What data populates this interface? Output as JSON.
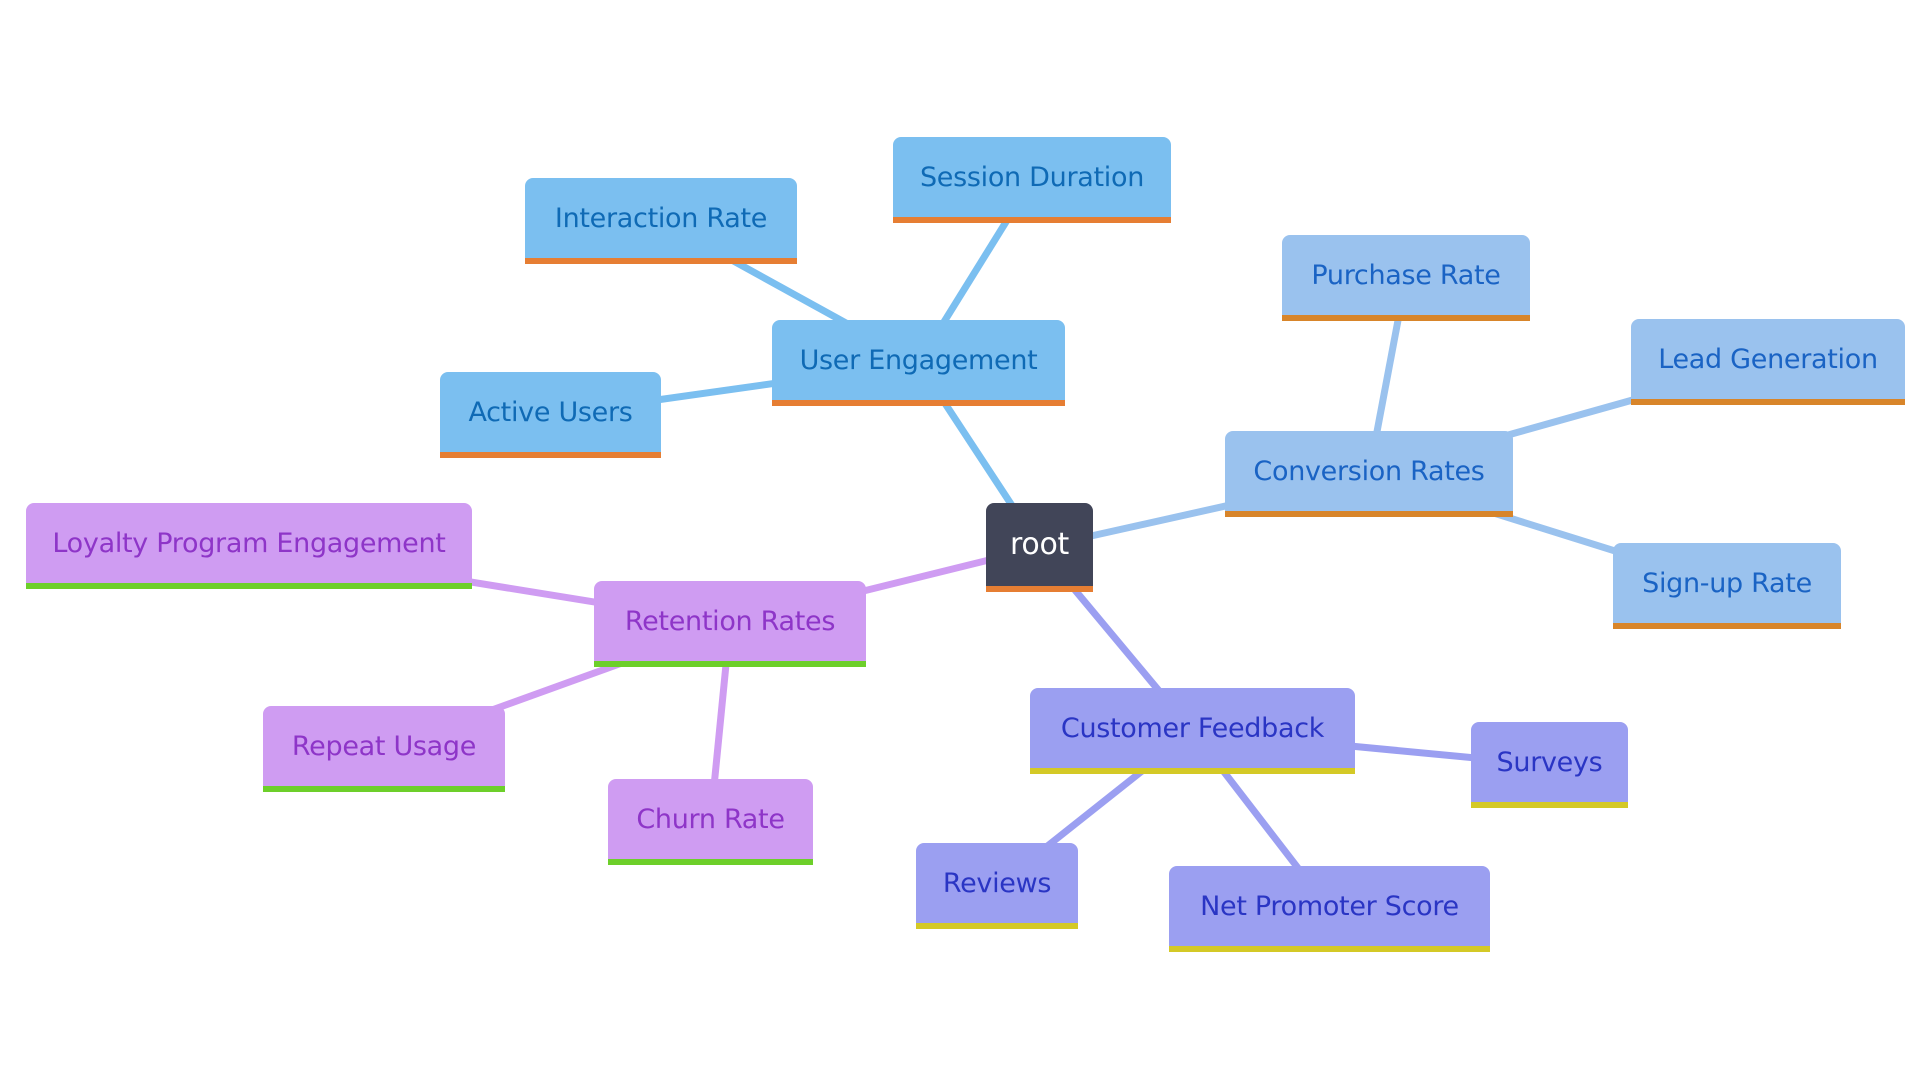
{
  "diagram": {
    "type": "mindmap",
    "root": {
      "id": "root",
      "label": "root",
      "fill": "#414558",
      "text_color": "#ffffff",
      "bar_color": "#E67E33"
    },
    "branches": [
      {
        "id": "user-engagement",
        "label": "User Engagement",
        "fill": "#7BBFF0",
        "text_color": "#0F6AB5",
        "bar_color": "#E67E33",
        "edge_color": "#7BBFF0",
        "children": [
          {
            "id": "interaction-rate",
            "label": "Interaction Rate"
          },
          {
            "id": "session-duration",
            "label": "Session Duration"
          },
          {
            "id": "active-users",
            "label": "Active Users"
          }
        ]
      },
      {
        "id": "conversion-rates",
        "label": "Conversion Rates",
        "fill": "#9AC2EE",
        "text_color": "#1A63C4",
        "bar_color": "#D8852A",
        "edge_color": "#9AC2EE",
        "children": [
          {
            "id": "purchase-rate",
            "label": "Purchase Rate"
          },
          {
            "id": "lead-generation",
            "label": "Lead Generation"
          },
          {
            "id": "sign-up-rate",
            "label": "Sign-up Rate"
          }
        ]
      },
      {
        "id": "retention-rates",
        "label": "Retention Rates",
        "fill": "#CF9CF2",
        "text_color": "#8E35C8",
        "bar_color": "#6DCF2A",
        "edge_color": "#CF9CF2",
        "children": [
          {
            "id": "loyalty-program-engagement",
            "label": "Loyalty Program Engagement"
          },
          {
            "id": "repeat-usage",
            "label": "Repeat Usage"
          },
          {
            "id": "churn-rate",
            "label": "Churn Rate"
          }
        ]
      },
      {
        "id": "customer-feedback",
        "label": "Customer Feedback",
        "fill": "#9B9FF1",
        "text_color": "#2A35C4",
        "bar_color": "#D4C926",
        "edge_color": "#9B9FF1",
        "children": [
          {
            "id": "surveys",
            "label": "Surveys"
          },
          {
            "id": "reviews",
            "label": "Reviews"
          },
          {
            "id": "net-promoter-score",
            "label": "Net Promoter Score"
          }
        ]
      }
    ]
  }
}
